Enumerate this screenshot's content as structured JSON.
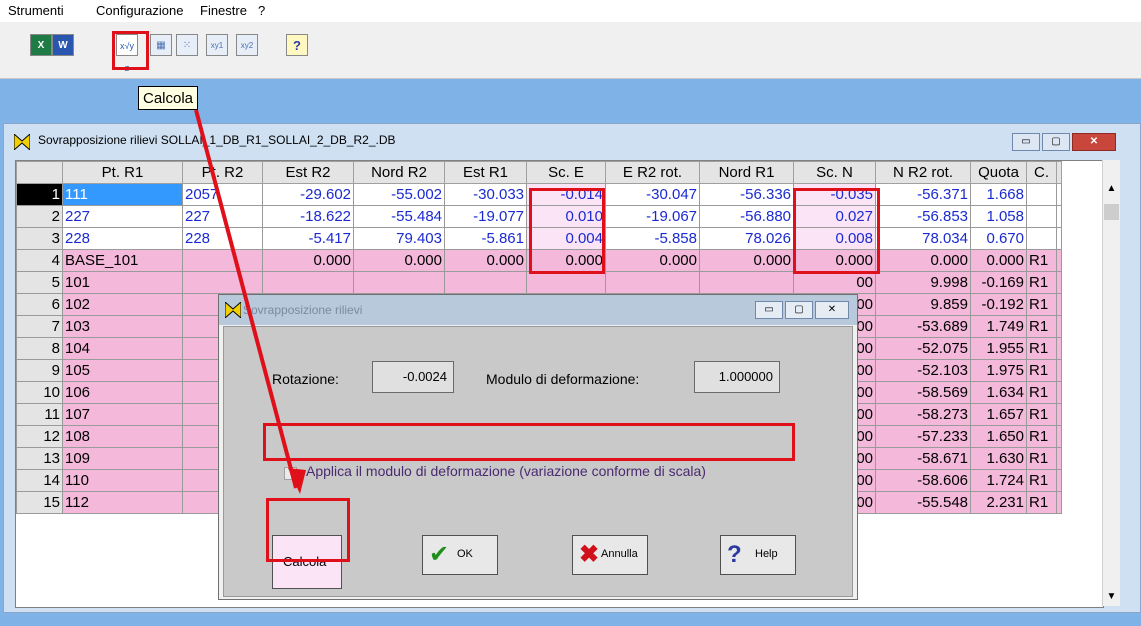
{
  "menu": {
    "items": [
      "Strumenti",
      "Configurazione",
      "Finestre",
      "?"
    ]
  },
  "toolbar": {
    "buttons": [
      {
        "name": "excel",
        "glyph": "X"
      },
      {
        "name": "word",
        "glyph": "W"
      },
      {
        "name": "calcola",
        "glyph": "x√y z"
      },
      {
        "name": "grid-a",
        "glyph": "▦"
      },
      {
        "name": "scatter",
        "glyph": "⁙"
      },
      {
        "name": "xy1",
        "glyph": "xy1"
      },
      {
        "name": "xy2",
        "glyph": "xy2"
      },
      {
        "name": "help",
        "glyph": "?"
      }
    ],
    "tooltip": "Calcola"
  },
  "window": {
    "title": "Sovrapposizione rilievi SOLLAI_1_DB_R1_SOLLAI_2_DB_R2_.DB",
    "controls": {
      "minimize": "▭",
      "maximize": "▢",
      "close": "✕"
    }
  },
  "table": {
    "columns": [
      "Pt. R1",
      "Pt. R2",
      "Est R2",
      "Nord R2",
      "Est R1",
      "Sc. E",
      "E R2 rot.",
      "Nord R1",
      "Sc. N",
      "N R2 rot.",
      "Quota",
      "C."
    ],
    "rows": [
      {
        "n": "1",
        "c": [
          "111",
          "2057",
          "-29.602",
          "-55.002",
          "-30.033",
          "-0.014",
          "-30.047",
          "-56.336",
          "-0.035",
          "-56.371",
          "1.668",
          ""
        ]
      },
      {
        "n": "2",
        "c": [
          "227",
          "227",
          "-18.622",
          "-55.484",
          "-19.077",
          "0.010",
          "-19.067",
          "-56.880",
          "0.027",
          "-56.853",
          "1.058",
          ""
        ]
      },
      {
        "n": "3",
        "c": [
          "228",
          "228",
          "-5.417",
          "79.403",
          "-5.861",
          "0.004",
          "-5.858",
          "78.026",
          "0.008",
          "78.034",
          "0.670",
          ""
        ]
      },
      {
        "n": "4",
        "c": [
          "BASE_101",
          "",
          "0.000",
          "0.000",
          "0.000",
          "0.000",
          "0.000",
          "0.000",
          "0.000",
          "0.000",
          "0.000",
          "R1"
        ]
      },
      {
        "n": "5",
        "c": [
          "101",
          "",
          "",
          "",
          "",
          "",
          "",
          "",
          "00",
          "9.998",
          "-0.169",
          "R1"
        ]
      },
      {
        "n": "6",
        "c": [
          "102",
          "",
          "",
          "",
          "",
          "",
          "",
          "",
          "00",
          "9.859",
          "-0.192",
          "R1"
        ]
      },
      {
        "n": "7",
        "c": [
          "103",
          "",
          "",
          "",
          "",
          "",
          "",
          "",
          "00",
          "-53.689",
          "1.749",
          "R1"
        ]
      },
      {
        "n": "8",
        "c": [
          "104",
          "",
          "",
          "",
          "",
          "",
          "",
          "",
          "00",
          "-52.075",
          "1.955",
          "R1"
        ]
      },
      {
        "n": "9",
        "c": [
          "105",
          "",
          "",
          "",
          "",
          "",
          "",
          "",
          "00",
          "-52.103",
          "1.975",
          "R1"
        ]
      },
      {
        "n": "10",
        "c": [
          "106",
          "",
          "",
          "",
          "",
          "",
          "",
          "",
          "00",
          "-58.569",
          "1.634",
          "R1"
        ]
      },
      {
        "n": "11",
        "c": [
          "107",
          "",
          "",
          "",
          "",
          "",
          "",
          "",
          "00",
          "-58.273",
          "1.657",
          "R1"
        ]
      },
      {
        "n": "12",
        "c": [
          "108",
          "",
          "",
          "",
          "",
          "",
          "",
          "",
          "00",
          "-57.233",
          "1.650",
          "R1"
        ]
      },
      {
        "n": "13",
        "c": [
          "109",
          "",
          "",
          "",
          "",
          "",
          "",
          "",
          "00",
          "-58.671",
          "1.630",
          "R1"
        ]
      },
      {
        "n": "14",
        "c": [
          "110",
          "",
          "",
          "",
          "",
          "",
          "",
          "",
          "00",
          "-58.606",
          "1.724",
          "R1"
        ]
      },
      {
        "n": "15",
        "c": [
          "112",
          "",
          "",
          "",
          "",
          "",
          "",
          "",
          "00",
          "-55.548",
          "2.231",
          "R1"
        ]
      }
    ]
  },
  "dialog": {
    "title": "Sovrapposizione rilievi",
    "rotazione_label": "Rotazione:",
    "rotazione_value": "-0.0024",
    "modulo_label": "Modulo di deformazione:",
    "modulo_value": "1.000000",
    "checkbox_label": "Applica il modulo di deformazione (variazione conforme di scala)",
    "checkbox_checked": false,
    "buttons": {
      "calcola": "Calcola",
      "ok": "OK",
      "annulla": "Annulla",
      "help": "Help"
    }
  },
  "colors": {
    "highlight_red": "#e0101a",
    "row_pink": "#f4b8da",
    "value_blue": "#1a2ad0",
    "desktop_blue": "#7fb2e6"
  }
}
